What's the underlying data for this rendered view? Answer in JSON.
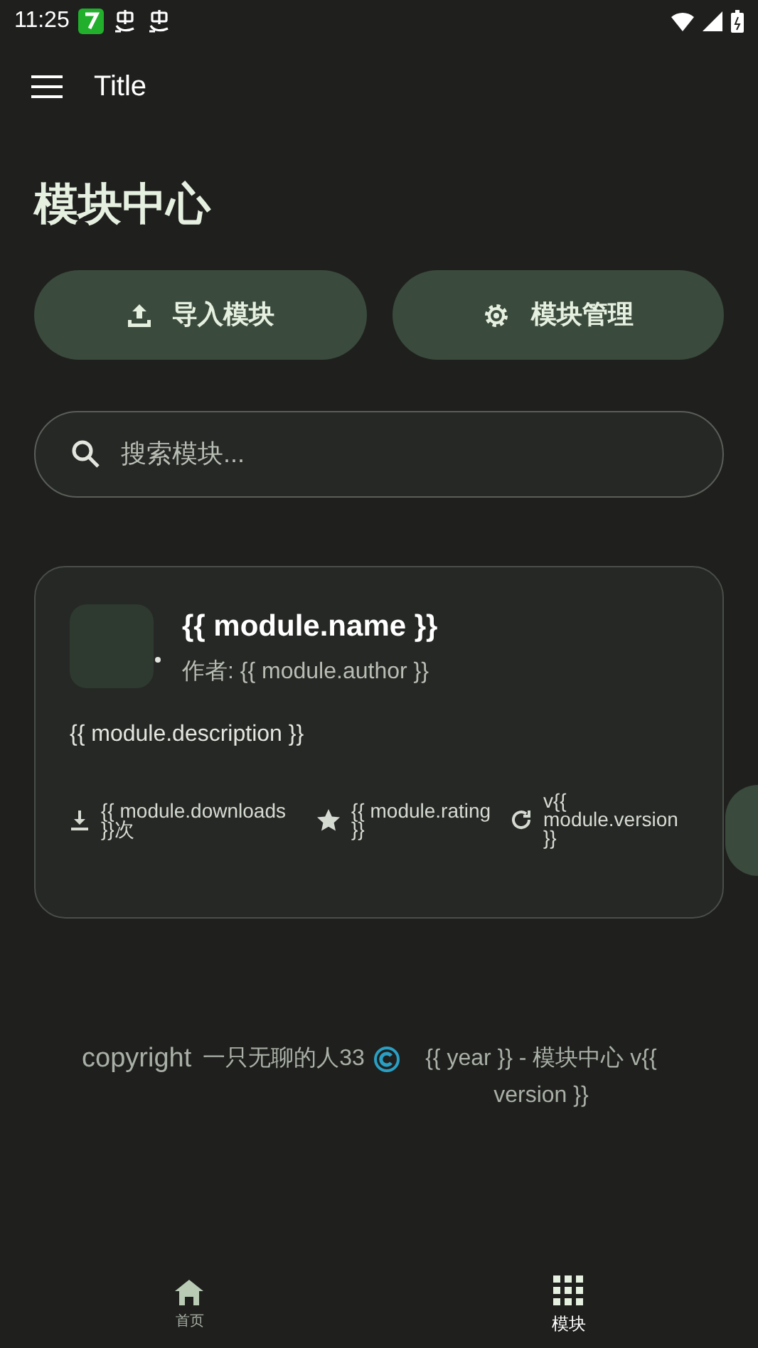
{
  "status_bar": {
    "time": "11:25"
  },
  "app_bar": {
    "title": "Title"
  },
  "heading": "模块中心",
  "actions": [
    {
      "label": "导入模块",
      "kind": "upload"
    },
    {
      "label": "模块管理",
      "kind": "settings"
    }
  ],
  "search": {
    "placeholder": "搜索模块..."
  },
  "module_card": {
    "name": "{{ module.name }}",
    "author": "作者: {{ module.author }}",
    "description": "{{ module.description }}",
    "stats": [
      {
        "kind": "downloads",
        "text": "{{ module.downloads }}次"
      },
      {
        "kind": "rating",
        "text": "{{ module.rating }}"
      },
      {
        "kind": "version",
        "text": "v{{ module.version }}"
      }
    ]
  },
  "footer": {
    "label": "copyright",
    "author": "一只无聊的人33",
    "text": "{{ year }} - 模块中心 v{{ version }}"
  },
  "bottom_nav": [
    {
      "label": "首页",
      "kind": "home",
      "selected": false
    },
    {
      "label": "模块",
      "kind": "modules",
      "selected": true
    }
  ]
}
